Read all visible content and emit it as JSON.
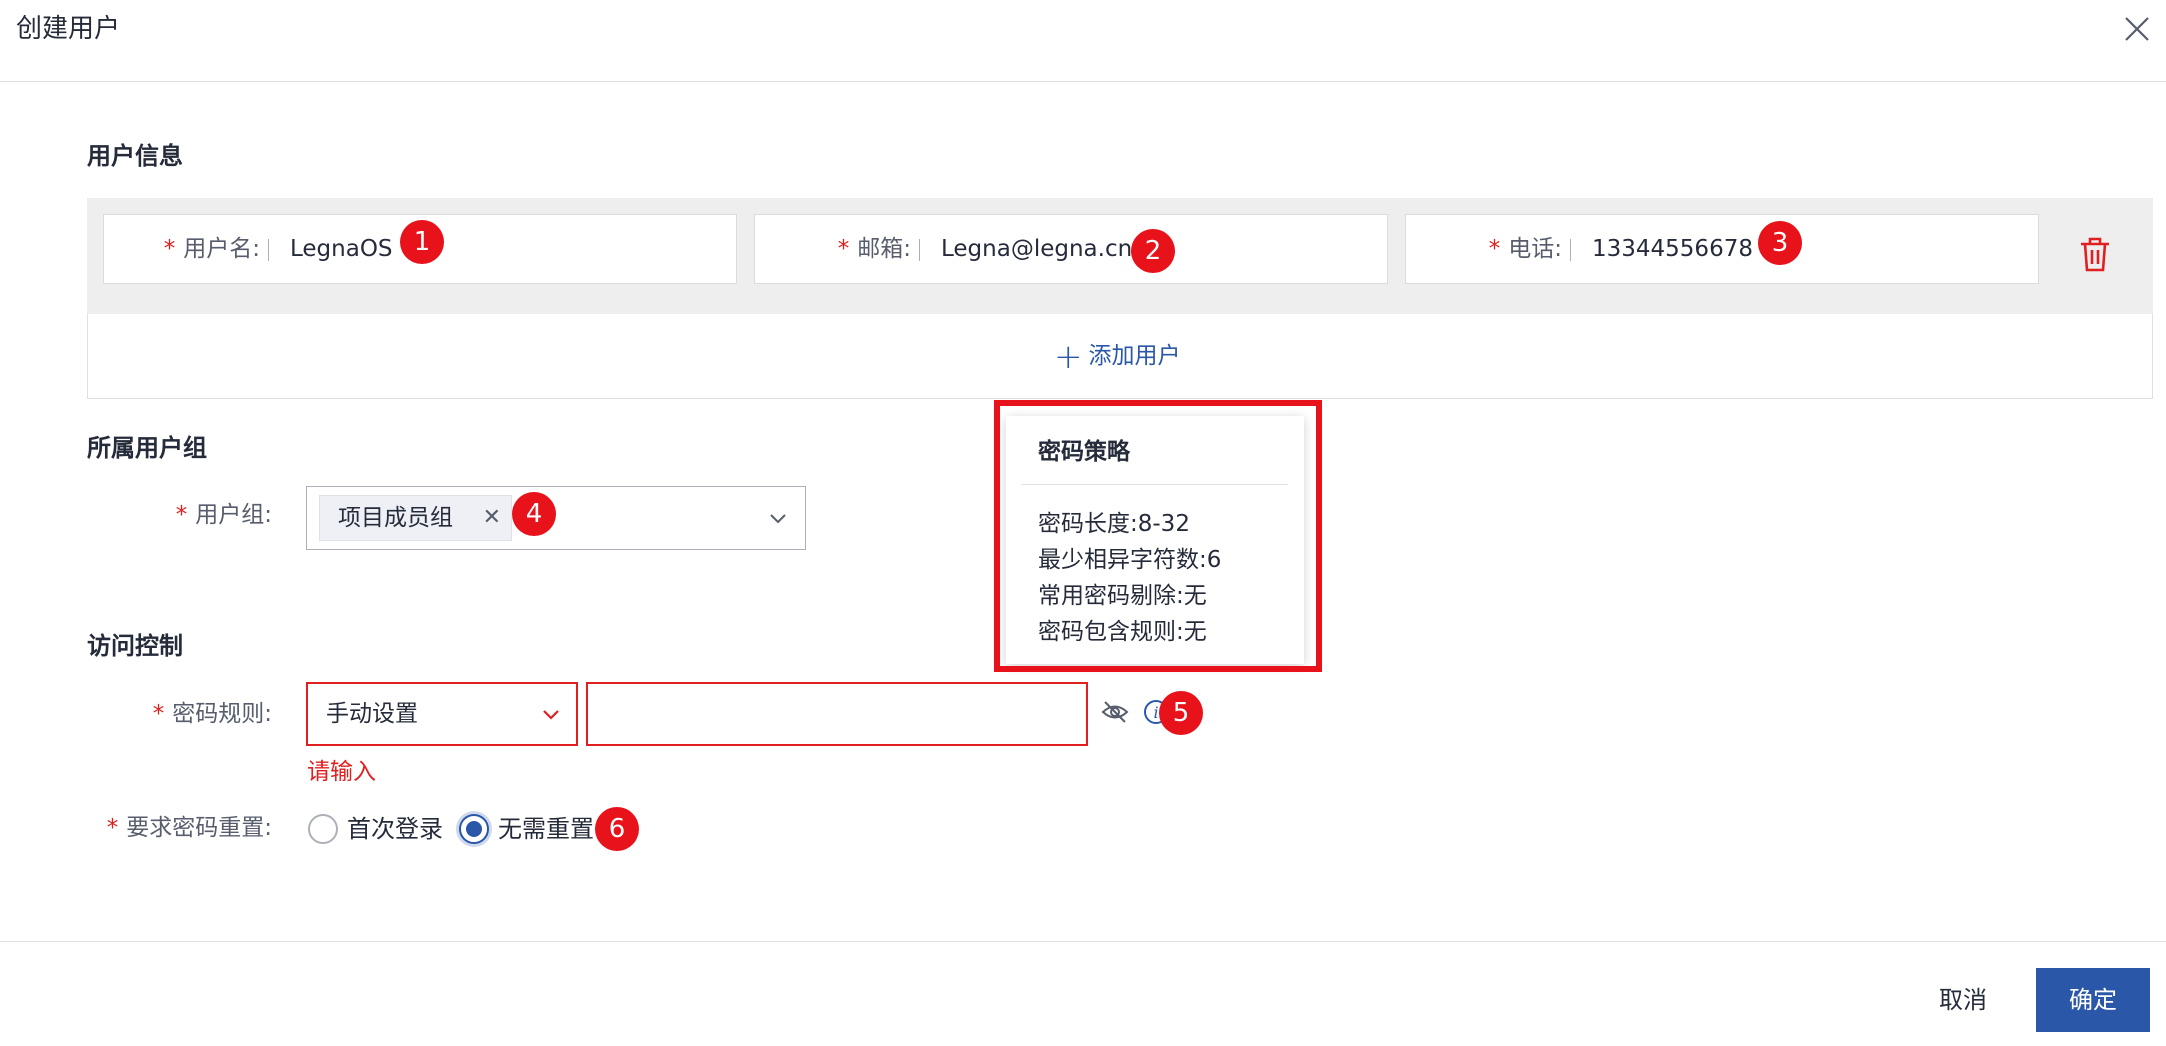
{
  "dialog": {
    "title": "创建用户"
  },
  "user_info": {
    "section_title": "用户信息",
    "fields": [
      {
        "label": "用户名:",
        "value": "LegnaOS",
        "badge": "1"
      },
      {
        "label": "邮箱:",
        "value": "Legna@legna.cn",
        "badge": "2"
      },
      {
        "label": "电话:",
        "value": "13344556678",
        "badge": "3"
      }
    ],
    "add_user_label": "添加用户"
  },
  "user_group": {
    "section_title": "所属用户组",
    "label": "用户组:",
    "tag": "项目成员组",
    "badge": "4"
  },
  "access": {
    "section_title": "访问控制",
    "password_rule_label": "密码规则:",
    "password_rule_value": "手动设置",
    "error_text": "请输入",
    "info_badge": "5",
    "reset_label": "要求密码重置:",
    "reset_options": [
      "首次登录",
      "无需重置"
    ],
    "reset_selected": "无需重置",
    "reset_badge": "6"
  },
  "password_policy": {
    "title": "密码策略",
    "lines": [
      "密码长度:8-32",
      "最少相异字符数:6",
      "常用密码剔除:无",
      "密码包含规则:无"
    ]
  },
  "footer": {
    "cancel_label": "取消",
    "ok_label": "确定"
  },
  "colors": {
    "primary": "#2a57a8",
    "required": "#e02020",
    "annotation": "#e8121b"
  }
}
